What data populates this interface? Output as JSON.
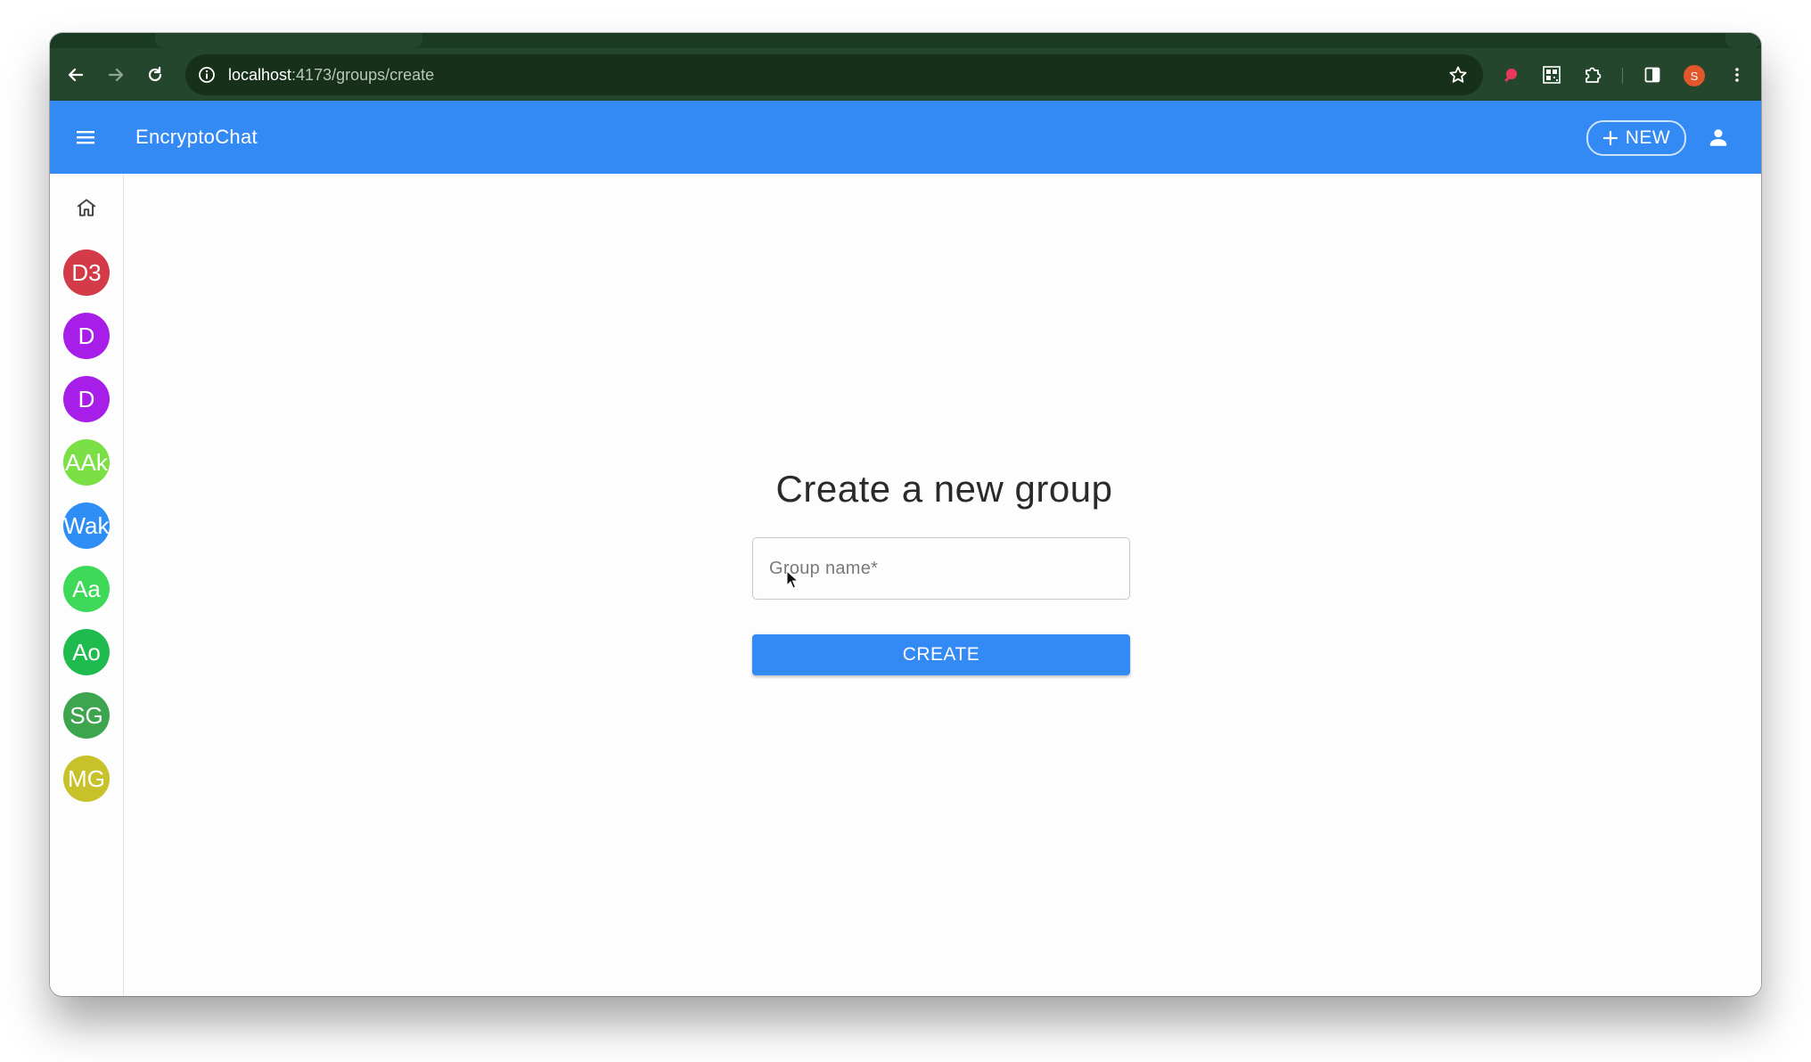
{
  "browser": {
    "url_host": "localhost",
    "url_path": ":4173/groups/create",
    "profile_initial": "S",
    "icons": {
      "back": "arrow-left-icon",
      "forward": "arrow-right-icon",
      "reload": "reload-icon",
      "info": "info-icon",
      "bookmark": "star-icon",
      "extensions": [
        "pink-extension-icon",
        "qr-code-icon",
        "puzzle-icon",
        "side-panel-icon"
      ],
      "menu": "kebab-menu-icon"
    },
    "colors": {
      "frame": "#24462c",
      "omnibox": "#173019",
      "profile": "#e2572b"
    }
  },
  "appbar": {
    "title": "EncryptoChat",
    "new_label": "NEW",
    "color": "#338af5",
    "icons": {
      "menu": "hamburger-menu-icon",
      "new": "plus-icon",
      "account": "person-icon"
    }
  },
  "sidebar": {
    "home_icon": "home-icon",
    "avatars": [
      {
        "label": "D3",
        "color": "#d23b47"
      },
      {
        "label": "D",
        "color": "#a81ee9"
      },
      {
        "label": "D",
        "color": "#a81ee9"
      },
      {
        "label": "AAk",
        "color": "#7be045"
      },
      {
        "label": "Wak",
        "color": "#2f8ef5"
      },
      {
        "label": "Aa",
        "color": "#3fd95a"
      },
      {
        "label": "Ao",
        "color": "#1fbb4f"
      },
      {
        "label": "SG",
        "color": "#3ea54f"
      },
      {
        "label": "MG",
        "color": "#c7c22a"
      }
    ]
  },
  "form": {
    "title": "Create a new group",
    "group_name_placeholder": "Group name*",
    "group_name_value": "",
    "submit_label": "CREATE"
  }
}
